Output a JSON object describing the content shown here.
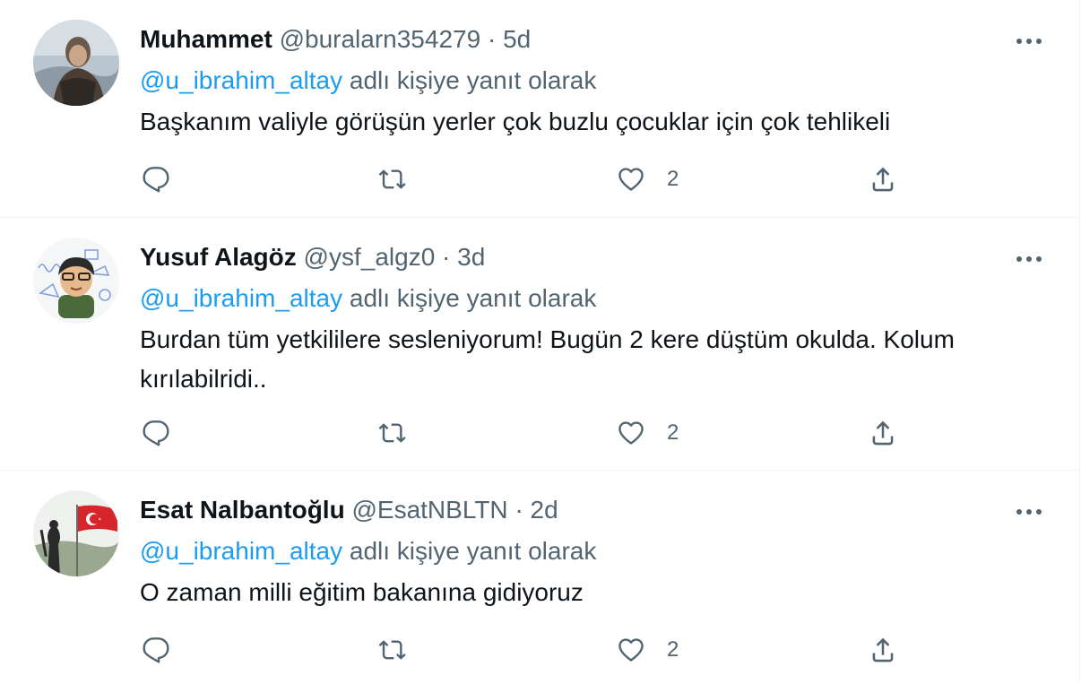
{
  "tweets": [
    {
      "name": "Muhammet",
      "handle": "@buralarn354279",
      "separator": "·",
      "time": "5d",
      "reply_to": "@u_ibrahim_altay",
      "reply_suffix": "adlı kişiye yanıt olarak",
      "text": "Başkanım valiyle görüşün yerler çok buzlu çocuklar için çok tehlikeli",
      "likes": "2"
    },
    {
      "name": "Yusuf Alagöz",
      "handle": "@ysf_algz0",
      "separator": "·",
      "time": "3d",
      "reply_to": "@u_ibrahim_altay",
      "reply_suffix": "adlı kişiye yanıt olarak",
      "text": "Burdan tüm yetkililere sesleniyorum! Bugün 2 kere düştüm okulda. Kolum kırılabilridi..",
      "likes": "2"
    },
    {
      "name": "Esat Nalbantoğlu",
      "handle": "@EsatNBLTN",
      "separator": "·",
      "time": "2d",
      "reply_to": "@u_ibrahim_altay",
      "reply_suffix": "adlı kişiye yanıt olarak",
      "text": "O zaman milli eğitim bakanına gidiyoruz",
      "likes": "2"
    }
  ],
  "icons": {
    "reply": "reply-icon",
    "retweet": "retweet-icon",
    "like": "heart-icon",
    "share": "share-icon",
    "more": "more-icon"
  },
  "colors": {
    "mention": "#1d9bf0",
    "secondary_text": "#536471",
    "primary_text": "#0f1419",
    "divider": "#eff3f4"
  }
}
